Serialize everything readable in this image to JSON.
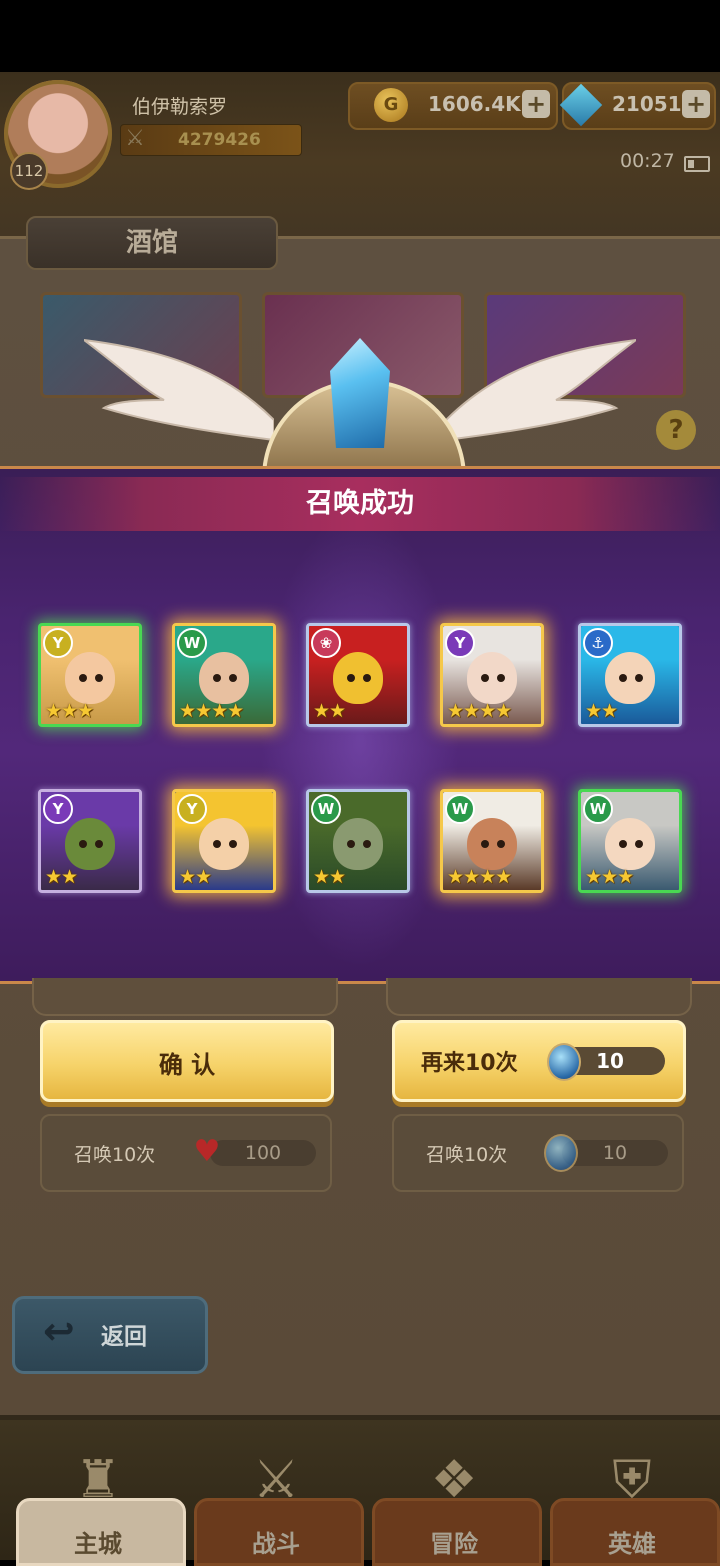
{
  "player": {
    "name": "伯伊勒索罗",
    "level": "112",
    "power": "4279426"
  },
  "resources": {
    "gold": "1606.4K",
    "gems": "21051"
  },
  "status": {
    "clock": "00:27"
  },
  "tavern": {
    "tab_label": "酒馆"
  },
  "modal": {
    "title": "召唤成功",
    "heroes": [
      {
        "faction_icon": "nature-icon",
        "faction_color": "#c8b020",
        "frame": "green",
        "stars": 3,
        "skin": "#f4c8a0",
        "hair": "#f0c070",
        "bg": "#c89a48"
      },
      {
        "faction_icon": "beast-icon",
        "faction_color": "#2a9a4a",
        "frame": "gold",
        "stars": 4,
        "skin": "#e8c0a0",
        "hair": "#2aa88a",
        "bg": "#3a6a38"
      },
      {
        "faction_icon": "flower-icon",
        "faction_color": "#c83a5a",
        "frame": "blue",
        "stars": 2,
        "skin": "#f0c030",
        "hair": "#c82020",
        "bg": "#6a1a1a"
      },
      {
        "faction_icon": "shadow-icon",
        "faction_color": "#7a3ab8",
        "frame": "gold",
        "stars": 4,
        "skin": "#f2d8c8",
        "hair": "#e8e4e0",
        "bg": "#7a5a50"
      },
      {
        "faction_icon": "anchor-icon",
        "faction_color": "#2a6ac8",
        "frame": "blue",
        "stars": 2,
        "skin": "#f4d4b8",
        "hair": "#2ab8e8",
        "bg": "#1a5a9a"
      },
      {
        "faction_icon": "shadow-icon",
        "faction_color": "#7a3ab8",
        "frame": "purple",
        "stars": 2,
        "skin": "#6a8a3a",
        "hair": "#6a3aa8",
        "bg": "#3a2a48"
      },
      {
        "faction_icon": "nature-icon",
        "faction_color": "#c8b020",
        "frame": "gold",
        "stars": 2,
        "skin": "#f4d0a8",
        "hair": "#f4c430",
        "bg": "#2a3a8a"
      },
      {
        "faction_icon": "beast-icon",
        "faction_color": "#2a9a4a",
        "frame": "blue",
        "stars": 2,
        "skin": "#8a9a70",
        "hair": "#4a6a2a",
        "bg": "#2a4a28"
      },
      {
        "faction_icon": "beast-icon",
        "faction_color": "#2a9a4a",
        "frame": "gold",
        "stars": 4,
        "skin": "#c8825a",
        "hair": "#f0ece4",
        "bg": "#5a3a28"
      },
      {
        "faction_icon": "beast-icon",
        "faction_color": "#2a9a4a",
        "frame": "green",
        "stars": 3,
        "skin": "#f4d8c0",
        "hair": "#c8c8c4",
        "bg": "#3a5a70"
      }
    ]
  },
  "buttons": {
    "confirm_label": "确 认",
    "again_label": "再来10次",
    "again_cost": "10",
    "summon10_heart_label": "召唤10次",
    "summon10_heart_cost": "100",
    "summon10_orb_label": "召唤10次",
    "summon10_orb_cost": "10",
    "back_label": "返回"
  },
  "nav": [
    {
      "label": "主城",
      "active": true
    },
    {
      "label": "战斗",
      "active": false
    },
    {
      "label": "冒险",
      "active": false
    },
    {
      "label": "英雄",
      "active": false
    }
  ],
  "colors": {
    "accent_gold": "#f6d36a",
    "modal_purple": "#4a2470",
    "title_band": "#a82e5e"
  }
}
